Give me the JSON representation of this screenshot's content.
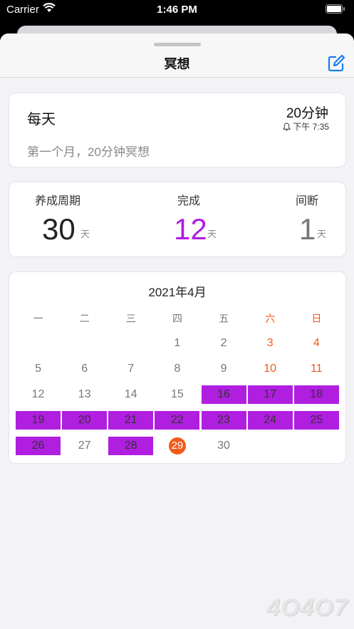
{
  "status": {
    "carrier": "Carrier",
    "time": "1:46 PM"
  },
  "nav": {
    "title": "冥想",
    "edit_icon": "edit-icon"
  },
  "habit": {
    "frequency": "每天",
    "duration": "20分钟",
    "reminder_time": "下午 7:35",
    "description": "第一个月，20分钟冥想"
  },
  "stats": [
    {
      "label": "养成周期",
      "value": "30",
      "unit": "天",
      "color": "#222222"
    },
    {
      "label": "完成",
      "value": "12",
      "unit": "天",
      "color": "#b01ee0"
    },
    {
      "label": "间断",
      "value": "1",
      "unit": "天",
      "color": "#777777"
    }
  ],
  "calendar": {
    "title": "2021年4月",
    "weekdays": [
      "一",
      "二",
      "三",
      "四",
      "五",
      "六",
      "日"
    ],
    "weekend_indices": [
      5,
      6
    ],
    "leading_blanks": 3,
    "days_in_month": 30,
    "completed_days": [
      16,
      17,
      18,
      19,
      20,
      21,
      22,
      23,
      24,
      25,
      26,
      28
    ],
    "today": 29,
    "done_color": "#b01ee0",
    "accent_color": "#f15a1a"
  },
  "watermark": "4O4O7"
}
